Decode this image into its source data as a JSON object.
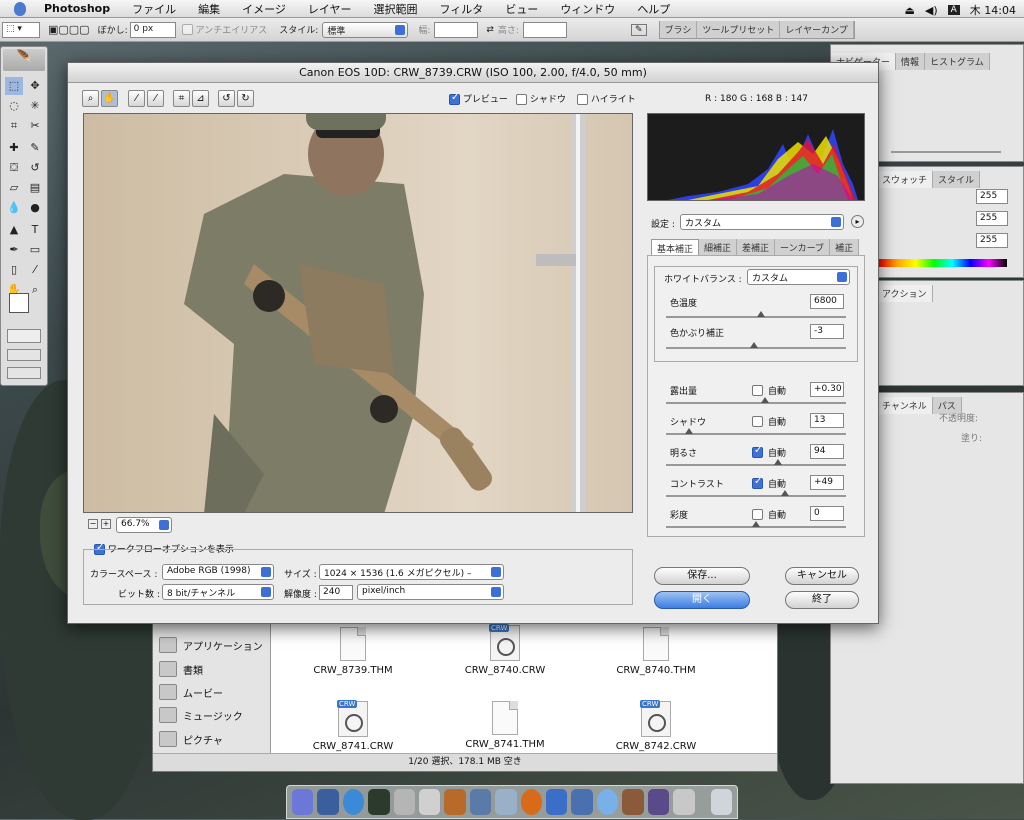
{
  "menubar": {
    "app": "Photoshop",
    "items": [
      "ファイル",
      "編集",
      "イメージ",
      "レイヤー",
      "選択範囲",
      "フィルタ",
      "ビュー",
      "ウィンドウ",
      "ヘルプ"
    ],
    "clock": "木 14:04",
    "input_indicator": "A"
  },
  "optionsbar": {
    "feather_label": "ぼかし:",
    "feather_value": "0 px",
    "antialias_label": "アンチエイリアス",
    "style_label": "スタイル:",
    "style_value": "標準",
    "width_label": "幅:",
    "height_label": "高さ:",
    "palette_tabs": [
      "ブラシ",
      "ツールプリセット",
      "レイヤーカンプ"
    ]
  },
  "panels": {
    "nav_tabs": [
      "ナビゲーター",
      "情報",
      "ヒストグラム"
    ],
    "swatch_tabs": [
      "スウォッチ",
      "スタイル"
    ],
    "swatch_values": [
      "255",
      "255",
      "255"
    ],
    "actions_tab": "アクション",
    "layers_tabs": [
      "チャンネル",
      "パス"
    ],
    "opacity_label": "不透明度:",
    "fill_label": "塗り:"
  },
  "dialog": {
    "title": "Canon EOS 10D:  CRW_8739.CRW  (ISO 100, 2.00, f/4.0, 50 mm)",
    "preview_label": "プレビュー",
    "shadow_label": "シャドウ",
    "highlight_label": "ハイライト",
    "rgb_readout": "R : 180  G : 168  B : 147",
    "zoom_value": "66.7%",
    "settings_label": "設定 :",
    "settings_value": "カスタム",
    "tabs": [
      "基本補正",
      "細補正",
      "差補正",
      "ーンカーブ",
      "補正"
    ],
    "wb_label": "ホワイトバランス :",
    "wb_value": "カスタム",
    "temp_label": "色温度",
    "temp_value": "6800",
    "temp_level": 0.53,
    "tint_label": "色かぶり補正",
    "tint_value": "-3",
    "tint_level": 0.49,
    "auto_label": "自動",
    "adjustments": [
      {
        "label": "露出量",
        "auto": false,
        "value": "+0.30",
        "level": 0.55
      },
      {
        "label": "シャドウ",
        "auto": false,
        "value": "13",
        "level": 0.13
      },
      {
        "label": "明るさ",
        "auto": true,
        "value": "94",
        "level": 0.62
      },
      {
        "label": "コントラスト",
        "auto": true,
        "value": "+49",
        "level": 0.66
      },
      {
        "label": "彩度",
        "auto": false,
        "value": "0",
        "level": 0.5
      }
    ],
    "workflow_label": "ワークフローオプションを表示",
    "colorspace_label": "カラースペース :",
    "colorspace_value": "Adobe RGB (1998)",
    "size_label": "サイズ :",
    "size_value": "1024 × 1536 (1.6 メガピクセル) –",
    "depth_label": "ビット数 :",
    "depth_value": "8 bit/チャンネル",
    "resolution_label": "解像度 :",
    "resolution_value": "240",
    "resolution_unit": "pixel/inch",
    "save_label": "保存...",
    "cancel_label": "キャンセル",
    "open_label": "開く",
    "done_label": "終了"
  },
  "finder": {
    "sidebar": [
      "アプリケーション",
      "書類",
      "ムービー",
      "ミュージック",
      "ピクチャ"
    ],
    "files": [
      {
        "name": "CRW_8739.THM",
        "kind": "thm"
      },
      {
        "name": "CRW_8740.CRW",
        "kind": "crw"
      },
      {
        "name": "CRW_8740.THM",
        "kind": "thm"
      },
      {
        "name": "CRW_8741.CRW",
        "kind": "crw"
      },
      {
        "name": "CRW_8741.THM",
        "kind": "thm"
      },
      {
        "name": "CRW_8742.CRW",
        "kind": "crw"
      }
    ],
    "status": "1/20 選択、178.1 MB 空き",
    "crw_badge": "CRW"
  },
  "colors": {
    "accent": "#3c7ee0",
    "histogram_bg": "#1a1a1a"
  }
}
